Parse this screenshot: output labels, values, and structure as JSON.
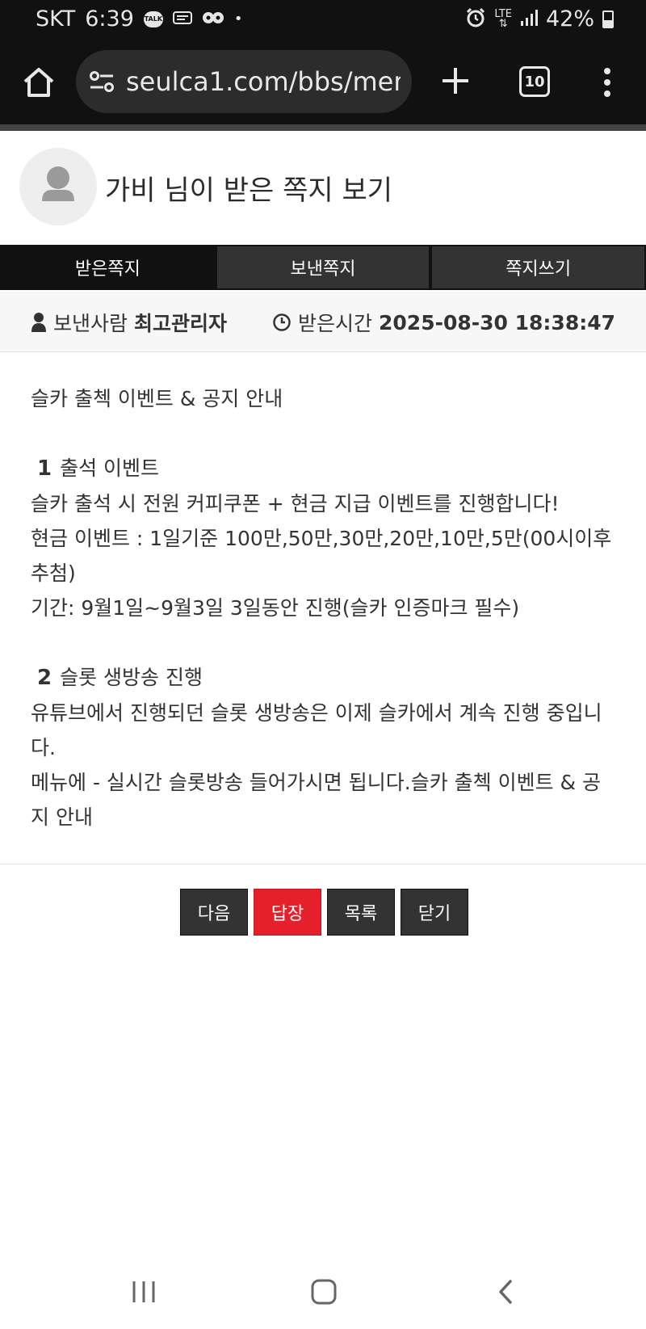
{
  "status_bar": {
    "carrier": "SKT",
    "time": "6:39",
    "talk_badge": "TALK",
    "network": "LTE",
    "battery": "42%"
  },
  "browser": {
    "url": "seulca1.com/bbs/mem",
    "tab_count": "10"
  },
  "page": {
    "title": "가비 님이 받은 쪽지 보기"
  },
  "tabs": [
    {
      "label": "받은쪽지",
      "active": true
    },
    {
      "label": "보낸쪽지",
      "active": false
    },
    {
      "label": "쪽지쓰기",
      "active": false
    }
  ],
  "info": {
    "sender_label": "보낸사람",
    "sender_name": "최고관리자",
    "time_label": "받은시간",
    "time_value": "2025-08-30 18:38:47"
  },
  "message": {
    "intro": "슬카 출첵 이벤트 & 공지 안내",
    "section1_num": "1",
    "section1_title": "출석 이벤트",
    "line1": "슬카 출석 시 전원 커피쿠폰 + 현금 지급 이벤트를 진행합니다!",
    "line2": "현금 이벤트 : 1일기준 100만,50만,30만,20만,10만,5만(00시이후 추첨)",
    "line3": "기간: 9월1일~9월3일 3일동안 진행(슬카 인증마크 필수)",
    "section2_num": "2",
    "section2_title": "슬롯 생방송 진행",
    "line4": "유튜브에서 진행되던 슬롯 생방송은 이제 슬카에서 계속 진행 중입니다.",
    "line5": "메뉴에 - 실시간 슬롯방송 들어가시면 됩니다.슬카 출첵 이벤트 & 공지 안내"
  },
  "buttons": {
    "next": "다음",
    "reply": "답장",
    "list": "목록",
    "close": "닫기"
  },
  "colors": {
    "accent_red": "#e5202b",
    "dark": "#333333",
    "toolbar": "#111111"
  }
}
